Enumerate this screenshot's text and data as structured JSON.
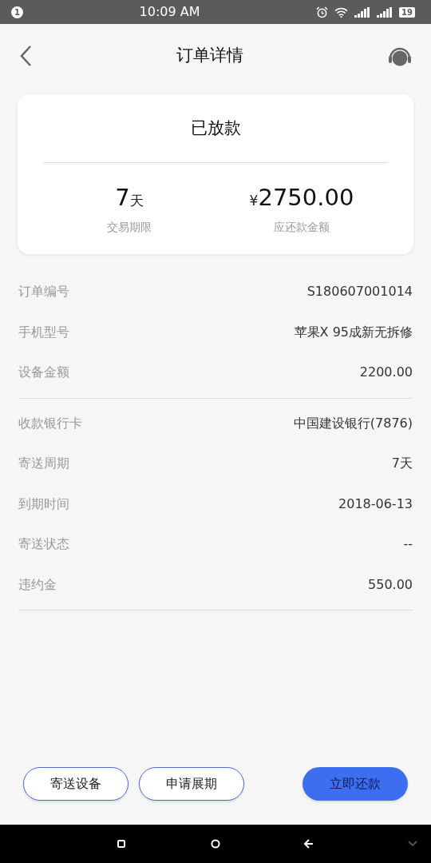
{
  "status_bar": {
    "notification_count": "1",
    "time": "10:09 AM",
    "battery": "19"
  },
  "header": {
    "title": "订单详情"
  },
  "summary": {
    "status": "已放款",
    "stats": [
      {
        "value": "7",
        "unit": "天",
        "label": "交易期限"
      },
      {
        "prefix": "¥",
        "value": "2750.00",
        "label": "应还款金额"
      }
    ]
  },
  "sections": [
    [
      {
        "label": "订单编号",
        "value": "S180607001014"
      },
      {
        "label": "手机型号",
        "value": "苹果X 95成新无拆修"
      },
      {
        "label": "设备金额",
        "value": "2200.00"
      }
    ],
    [
      {
        "label": "收款银行卡",
        "value": "中国建设银行(7876)"
      },
      {
        "label": "寄送周期",
        "value": "7天"
      },
      {
        "label": "到期时间",
        "value": "2018-06-13"
      },
      {
        "label": "寄送状态",
        "value": "--"
      },
      {
        "label": "违约金",
        "value": "550.00"
      }
    ]
  ],
  "actions": [
    {
      "label": "寄送设备",
      "kind": "outline"
    },
    {
      "label": "申请展期",
      "kind": "outline"
    },
    {
      "label": "立即还款",
      "kind": "primary"
    }
  ]
}
